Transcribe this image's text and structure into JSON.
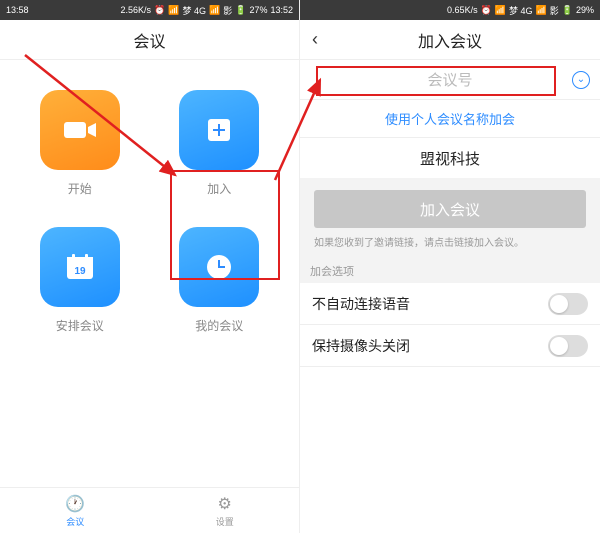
{
  "left": {
    "status": {
      "time": "13:58",
      "speed": "2.56K/s",
      "net": "梦 4G",
      "icons": "影",
      "battery": "27%",
      "time2": "13:52"
    },
    "nav": {
      "title": "会议"
    },
    "tiles": {
      "start": "开始",
      "join": "加入",
      "schedule": "安排会议",
      "mine": "我的会议"
    },
    "tabs": {
      "meeting": "会议",
      "settings": "设置"
    }
  },
  "right": {
    "status": {
      "time": "",
      "speed": "0.65K/s",
      "net": "梦 4G",
      "icons": "影",
      "battery": "29%"
    },
    "nav": {
      "title": "加入会议"
    },
    "input_placeholder": "会议号",
    "personal_link": "使用个人会议名称加会",
    "display_name": "盟视科技",
    "join_button": "加入会议",
    "hint": "如果您收到了邀请链接，请点击链接加入会议。",
    "section": "加会选项",
    "opt_audio": "不自动连接语音",
    "opt_video": "保持摄像头关闭"
  }
}
